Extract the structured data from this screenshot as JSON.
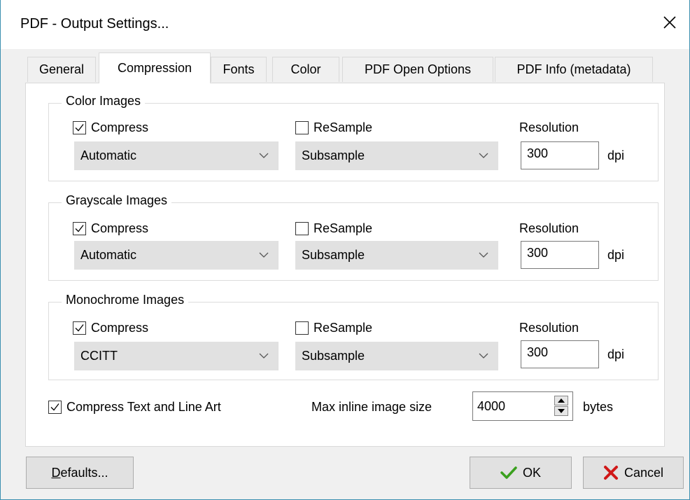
{
  "window": {
    "title": "PDF - Output Settings..."
  },
  "tabs": [
    {
      "label": "General"
    },
    {
      "label": "Compression"
    },
    {
      "label": "Fonts"
    },
    {
      "label": "Color"
    },
    {
      "label": "PDF Open Options"
    },
    {
      "label": "PDF Info (metadata)"
    }
  ],
  "active_tab": "Compression",
  "groups": [
    {
      "title": "Color Images",
      "compress_label": "Compress",
      "compress_checked": true,
      "compression_method": "Automatic",
      "resample_label": "ReSample",
      "resample_checked": false,
      "resample_method": "Subsample",
      "resolution_label": "Resolution",
      "resolution_value": "300",
      "resolution_unit": "dpi"
    },
    {
      "title": "Grayscale Images",
      "compress_label": "Compress",
      "compress_checked": true,
      "compression_method": "Automatic",
      "resample_label": "ReSample",
      "resample_checked": false,
      "resample_method": "Subsample",
      "resolution_label": "Resolution",
      "resolution_value": "300",
      "resolution_unit": "dpi"
    },
    {
      "title": "Monochrome Images",
      "compress_label": "Compress",
      "compress_checked": true,
      "compression_method": "CCITT",
      "resample_label": "ReSample",
      "resample_checked": false,
      "resample_method": "Subsample",
      "resolution_label": "Resolution",
      "resolution_value": "300",
      "resolution_unit": "dpi"
    }
  ],
  "compress_text": {
    "label": "Compress Text and Line Art",
    "checked": true
  },
  "max_inline": {
    "label": "Max inline image size",
    "value": "4000",
    "unit": "bytes"
  },
  "buttons": {
    "defaults_accel": "D",
    "defaults_rest": "efaults...",
    "ok": "OK",
    "cancel": "Cancel"
  },
  "colors": {
    "ok_icon": "#3aa01e",
    "cancel_icon": "#d01818",
    "window_border": "#3c8fb0"
  }
}
